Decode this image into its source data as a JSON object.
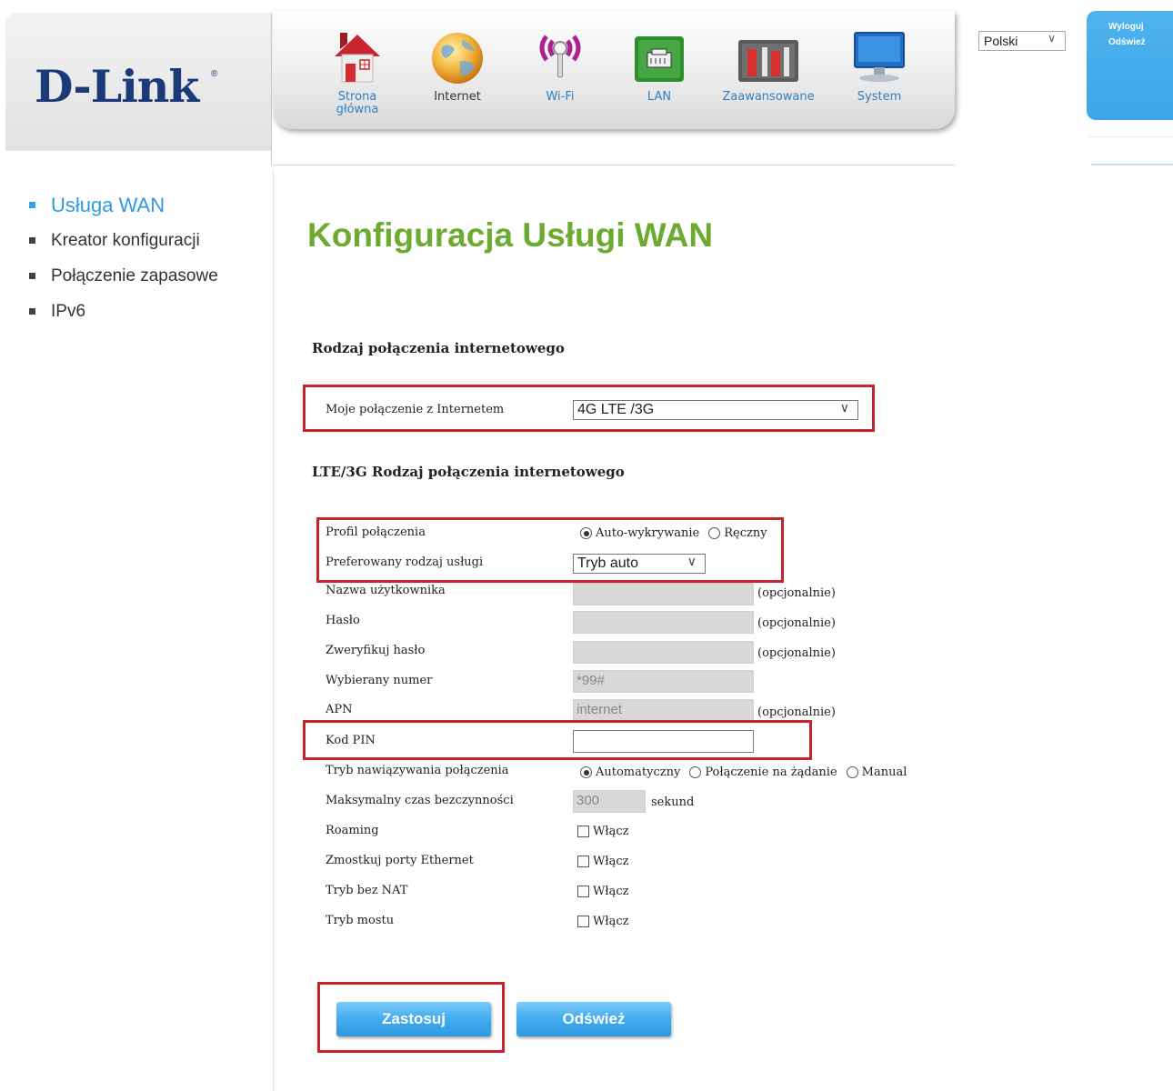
{
  "brand": {
    "logo": "D-Link",
    "reg": "®"
  },
  "nav": [
    {
      "label": "Strona główna",
      "icon": "house-icon",
      "active": false
    },
    {
      "label": "Internet",
      "icon": "globe-icon",
      "active": true
    },
    {
      "label": "Wi-Fi",
      "icon": "wifi-icon",
      "active": false
    },
    {
      "label": "LAN",
      "icon": "lan-port-icon",
      "active": false
    },
    {
      "label": "Zaawansowane",
      "icon": "tools-icon",
      "active": false
    },
    {
      "label": "System",
      "icon": "monitor-icon",
      "active": false
    }
  ],
  "language": {
    "selected": "Polski"
  },
  "side_tab": {
    "logout": "Wyloguj",
    "refresh": "Odśwież"
  },
  "sidebar": {
    "items": [
      {
        "label": "Usługa WAN",
        "active": true
      },
      {
        "label": "Kreator konfiguracji",
        "active": false
      },
      {
        "label": "Połączenie zapasowe",
        "active": false
      },
      {
        "label": "IPv6",
        "active": false
      }
    ]
  },
  "page": {
    "title": "Konfiguracja Usługi WAN"
  },
  "section1": {
    "title": "Rodzaj połączenia internetowego",
    "connection_label": "Moje połączenie z Internetem",
    "connection_value": "4G LTE /3G"
  },
  "section2": {
    "title": "LTE/3G Rodzaj połączenia internetowego",
    "profile_label": "Profil połączenia",
    "profile_options": [
      "Auto-wykrywanie",
      "Ręczny"
    ],
    "service_label": "Preferowany rodzaj usługi",
    "service_value": "Tryb auto",
    "username_label": "Nazwa użytkownika",
    "password_label": "Hasło",
    "verify_label": "Zweryfikuj hasło",
    "dial_label": "Wybierany numer",
    "dial_value": "*99#",
    "apn_label": "APN",
    "apn_value": "internet",
    "pin_label": "Kod PIN",
    "pin_value": "",
    "optional": "(opcjonalnie)",
    "mode_label": "Tryb nawiązywania połączenia",
    "mode_options": [
      "Automatyczny",
      "Połączenie na żądanie",
      "Manual"
    ],
    "idle_label": "Maksymalny czas bezczynności",
    "idle_value": "300",
    "idle_unit": "sekund",
    "roaming_label": "Roaming",
    "bridge_eth_label": "Zmostkuj porty Ethernet",
    "nonat_label": "Tryb bez NAT",
    "bridge_label": "Tryb mostu",
    "enable": "Włącz"
  },
  "buttons": {
    "apply": "Zastosuj",
    "refresh": "Odśwież"
  },
  "colors": {
    "title_green": "#6cab2f",
    "accent_blue": "#2f9ae0",
    "highlight_red": "#c6242f"
  }
}
